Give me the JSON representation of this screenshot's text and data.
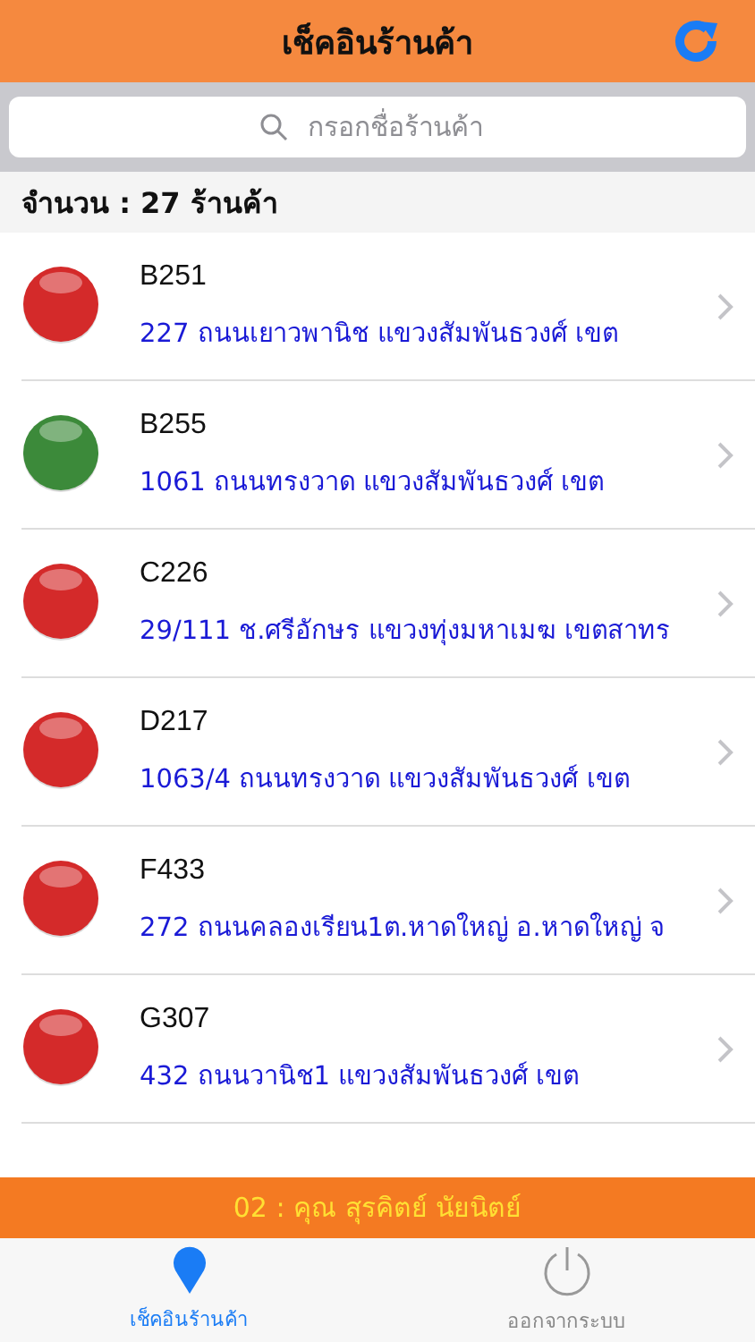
{
  "header": {
    "title": "เช็คอินร้านค้า"
  },
  "search": {
    "placeholder": "กรอกชื่อร้านค้า"
  },
  "count": "จำนวน : 27 ร้านค้า",
  "stores": [
    {
      "code": "B251",
      "address": "227 ถนนเยาวพานิช แขวงสัมพันธวงศ์ เขต",
      "color": "#d42a2a"
    },
    {
      "code": "B255",
      "address": "1061 ถนนทรงวาด แขวงสัมพันธวงศ์ เขต",
      "color": "#3c8a3a"
    },
    {
      "code": "C226",
      "address": "29/111 ช.ศรีอักษร แขวงทุ่งมหาเมฆ เขตสาทร",
      "color": "#d42a2a"
    },
    {
      "code": "D217",
      "address": "1063/4 ถนนทรงวาด แขวงสัมพันธวงศ์ เขต",
      "color": "#d42a2a"
    },
    {
      "code": "F433",
      "address": "272 ถนนคลองเรียน1ต.หาดใหญ่ อ.หาดใหญ่ จ",
      "color": "#d42a2a"
    },
    {
      "code": "G307",
      "address": "432  ถนนวานิช1 แขวงสัมพันธวงศ์ เขต",
      "color": "#d42a2a"
    }
  ],
  "user_banner": "02 : คุณ สุรคิตย์ นัยนิตย์",
  "tabs": [
    {
      "label": "เช็คอินร้านค้า",
      "kind": "pin",
      "selected": true
    },
    {
      "label": "ออกจากระบบ",
      "kind": "power",
      "selected": false
    }
  ]
}
